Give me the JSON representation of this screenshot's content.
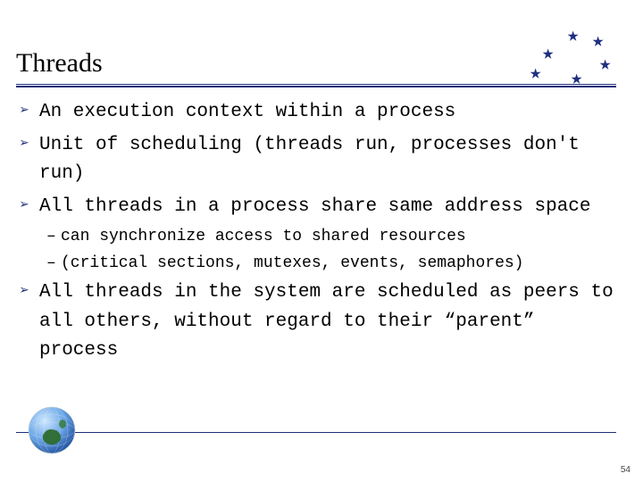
{
  "title": "Threads",
  "bullets": [
    {
      "level": 1,
      "text": "An execution context within a process"
    },
    {
      "level": 1,
      "text": "Unit of scheduling (threads run, processes don't run)"
    },
    {
      "level": 1,
      "text": "All threads in a process share same address space"
    },
    {
      "level": 2,
      "text": "can synchronize access to shared resources"
    },
    {
      "level": 2,
      "text": "(critical sections, mutexes, events, semaphores)"
    },
    {
      "level": 1,
      "text": "All threads in the system are scheduled as peers to all others, without regard to their “parent” process"
    }
  ],
  "page_number": "54",
  "colors": {
    "accent": "#203080",
    "rule": "#1d2f7a"
  },
  "glyphs": {
    "level1": "➢",
    "level2": "–",
    "star": "★"
  },
  "logo_name": "globe-australia-icon"
}
